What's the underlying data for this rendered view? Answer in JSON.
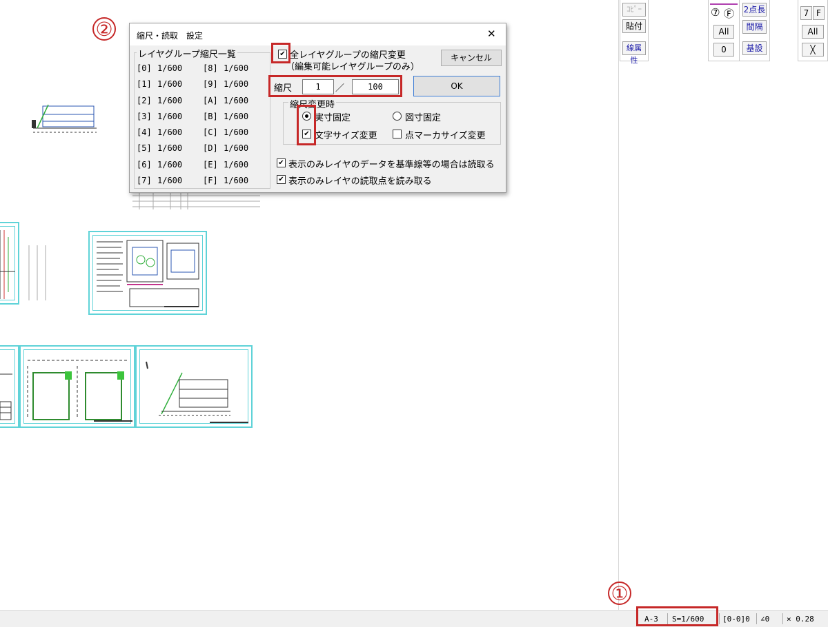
{
  "dialog": {
    "title": "縮尺・読取　設定",
    "close_glyph": "✕",
    "list_group_label": "レイヤグループ縮尺一覧",
    "layer_scales_left": [
      {
        "id": "[0]",
        "scale": "1/600"
      },
      {
        "id": "[1]",
        "scale": "1/600"
      },
      {
        "id": "[2]",
        "scale": "1/600"
      },
      {
        "id": "[3]",
        "scale": "1/600"
      },
      {
        "id": "[4]",
        "scale": "1/600"
      },
      {
        "id": "[5]",
        "scale": "1/600"
      },
      {
        "id": "[6]",
        "scale": "1/600"
      },
      {
        "id": "[7]",
        "scale": "1/600"
      }
    ],
    "layer_scales_right": [
      {
        "id": "[8]",
        "scale": "1/600"
      },
      {
        "id": "[9]",
        "scale": "1/600"
      },
      {
        "id": "[A]",
        "scale": "1/600"
      },
      {
        "id": "[B]",
        "scale": "1/600"
      },
      {
        "id": "[C]",
        "scale": "1/600"
      },
      {
        "id": "[D]",
        "scale": "1/600"
      },
      {
        "id": "[E]",
        "scale": "1/600"
      },
      {
        "id": "[F]",
        "scale": "1/600"
      }
    ],
    "all_layers_label": "全レイヤグループの縮尺変更",
    "all_layers_sub": "（編集可能レイヤグループのみ）",
    "all_layers_checked": true,
    "cancel_label": "キャンセル",
    "scale_label": "縮尺",
    "scale_numerator": "1",
    "scale_separator": "／",
    "scale_denominator": "100",
    "ok_label": "OK",
    "on_change_group_label": "縮尺変更時",
    "radio_actual": "実寸固定",
    "radio_drawing": "図寸固定",
    "radio_selected": "actual",
    "text_size_label": "文字サイズ変更",
    "text_size_checked": true,
    "point_marker_label": "点マーカサイズ変更",
    "point_marker_checked": false,
    "read_baseline_label": "表示のみレイヤのデータを基準線等の場合は読取る",
    "read_baseline_checked": true,
    "read_points_label": "表示のみレイヤの読取点を読み取る",
    "read_points_checked": true,
    "check_glyph": "✔",
    "radio_dot": "●"
  },
  "toolbar": {
    "copy": "ｺﾋﾟｰ",
    "paste": "貼付",
    "line_attr": "線属性",
    "circle7": "⑦",
    "circleF": "Ⓕ",
    "two_point_length": "2点長",
    "interval": "間隔",
    "all": "All",
    "zero": "0",
    "base_setting": "基設",
    "seven": "7",
    "f": "F",
    "all2": "All",
    "cross": "╳"
  },
  "status": {
    "paper": "A-3",
    "scale": "S=1/600",
    "layer": "[0-0]0",
    "angle": "∠0",
    "zoom": "× 0.28"
  },
  "annotations": {
    "marker1": "①",
    "marker2": "②"
  },
  "colors": {
    "sheet_border": "#5fd3d8",
    "annotation_red": "#c62828",
    "link_blue": "#1a1aa8"
  }
}
